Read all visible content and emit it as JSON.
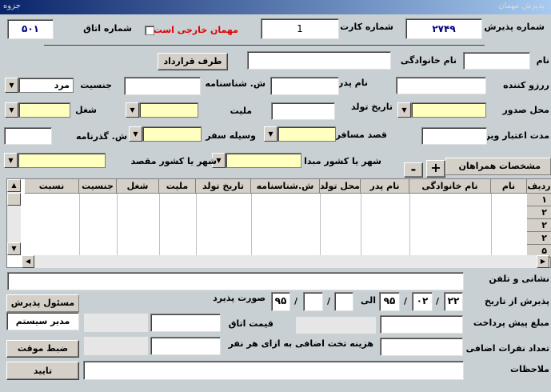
{
  "window": {
    "title": "پذیرش مهمان",
    "corner": "جزوه"
  },
  "header": {
    "reception_no_label": "شماره پذیرش",
    "reception_no": "۲۷۴۹",
    "card_no_label": "شماره کارت",
    "card_no": "1",
    "foreign_guest_label": "مهمان خارجی است",
    "room_no_label": "شماره اتاق",
    "room_no": "۵۰۱"
  },
  "fields": {
    "first_name": "نام",
    "last_name": "نام خانوادگی",
    "contract_party_button": "طرف قرارداد",
    "referrer": "ررزو کننده",
    "father_name": "نام پدر",
    "id_no": "ش. شناسنامه",
    "gender": "جنسیت",
    "gender_value": "مرد",
    "issue_place": "محل صدور",
    "birth_date": "تاریخ تولد",
    "nationality": "ملیت",
    "job": "شغل",
    "visa_validity": "مدت اعتبار ویزا",
    "travel_purpose": "قصد مسافرت",
    "travel_vehicle": "وسیله سفر",
    "passport_no": "ش. گذرنامه",
    "origin_city": "شهر یا کشور مبدا",
    "destination_city": "شهر یا کشور مقصد",
    "companions": "مشخصات همراهان",
    "add": "+",
    "remove": "-"
  },
  "grid": {
    "columns": [
      "ردیف",
      "نام",
      "نام خانوادگی",
      "نام پدر",
      "محل تولد",
      "ش.شناسنامه",
      "تاریخ تولد",
      "ملیت",
      "شغل",
      "جنسیت",
      "نسبت"
    ],
    "rows": [
      "۱",
      "۲",
      "۲",
      "۲",
      "۵"
    ]
  },
  "bottom": {
    "address": "نشانی و تلفن",
    "reception_from": "پذیرش از تاریخ",
    "date1_day": "۲۲",
    "date1_month": "۰۲",
    "date1_year": "۹۵",
    "to": "الی",
    "date2_day": "",
    "date2_month": "",
    "date2_year": "۹۵",
    "slash": "/",
    "accepted": "صورت پذیرد",
    "prepayment": "مبلغ پیش پرداخت",
    "room_price": "قیمت اتاق",
    "extra_count": "تعداد نفرات اضافی",
    "extra_bed_cost": "هزینه تخت اضافی به ازای هر نفر",
    "notes": "ملاحظات",
    "operator_header": "مسئول پذیرش",
    "operator_value": "مدیر سیستم",
    "save_temp": "ضبط موقت",
    "confirm": "تایید"
  }
}
